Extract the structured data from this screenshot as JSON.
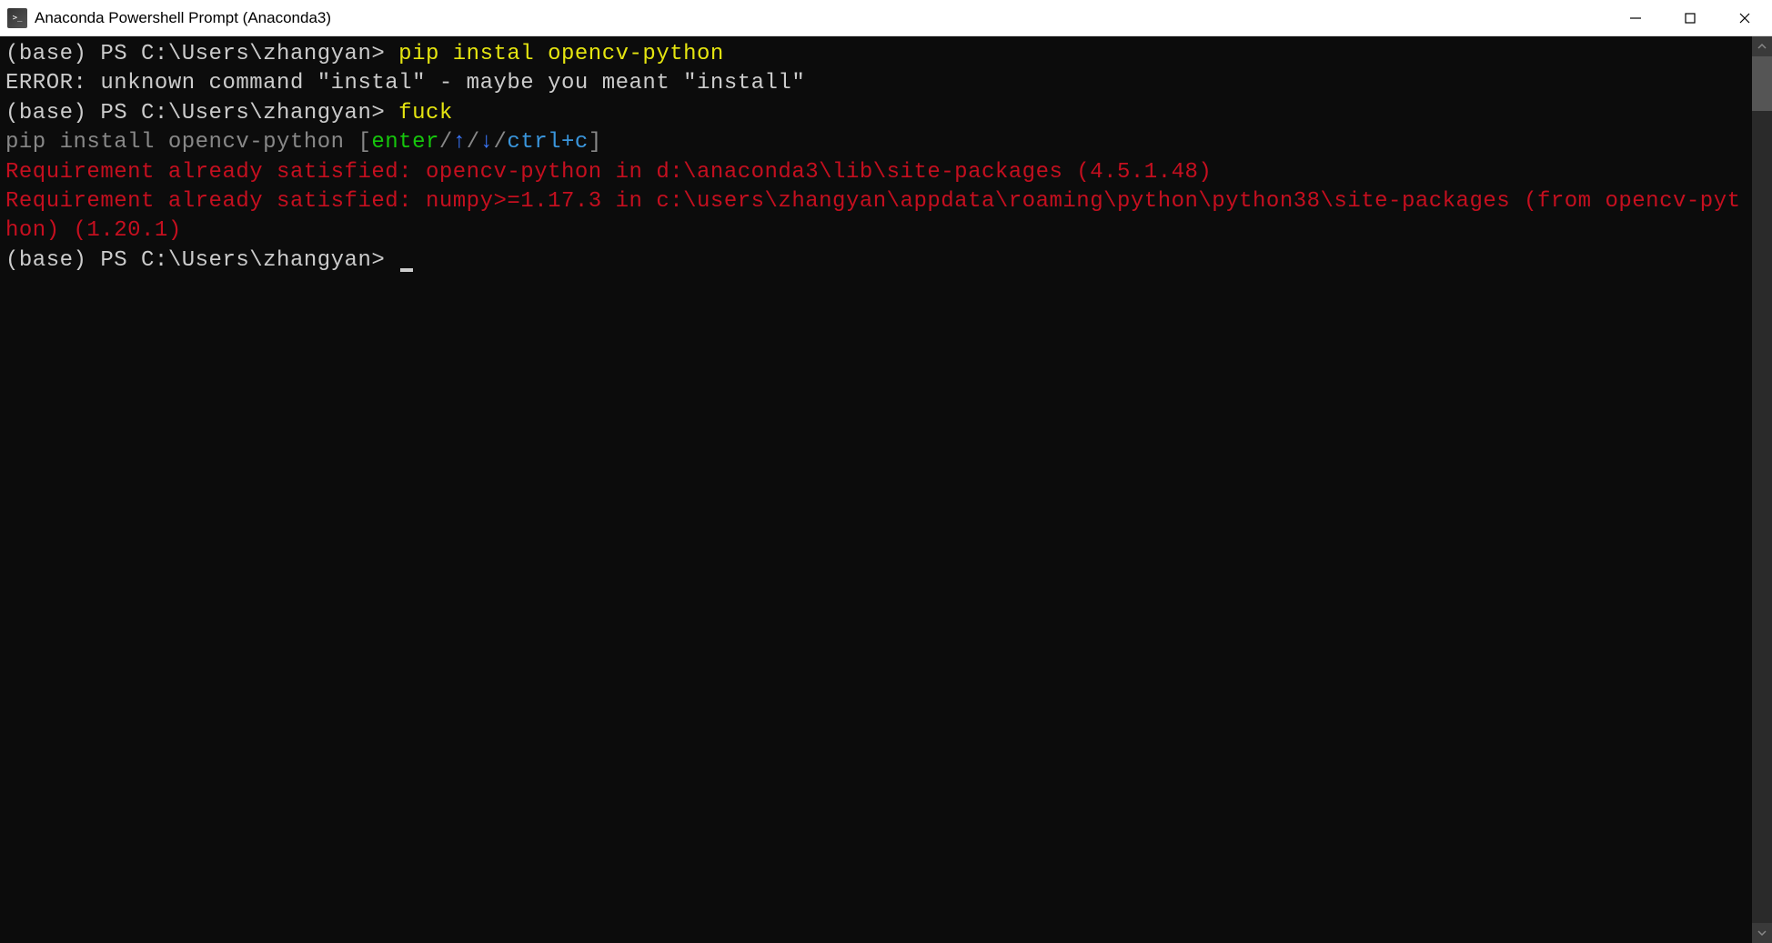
{
  "titlebar": {
    "title": "Anaconda Powershell Prompt (Anaconda3)"
  },
  "terminal": {
    "line1": {
      "prompt": "(base) PS C:\\Users\\zhangyan> ",
      "command": "pip instal opencv-python"
    },
    "line2": {
      "error": "ERROR: unknown command \"instal\" - maybe you meant \"install\""
    },
    "line3": {
      "prompt": "(base) PS C:\\Users\\zhangyan> ",
      "command": "fuck"
    },
    "line4": {
      "suggestion": "pip install opencv-python ",
      "bracket_open": "[",
      "enter": "enter",
      "slash1": "/",
      "up_arrow": "↑",
      "slash2": "/",
      "down_arrow": "↓",
      "slash3": "/",
      "ctrlc": "ctrl+c",
      "bracket_close": "]"
    },
    "line5": {
      "text": "Requirement already satisfied: opencv-python in d:\\anaconda3\\lib\\site-packages (4.5.1.48)"
    },
    "line6": {
      "text": "Requirement already satisfied: numpy>=1.17.3 in c:\\users\\zhangyan\\appdata\\roaming\\python\\python38\\site-packages (from opencv-python) (1.20.1)"
    },
    "line7": {
      "prompt": "(base) PS C:\\Users\\zhangyan> "
    }
  }
}
